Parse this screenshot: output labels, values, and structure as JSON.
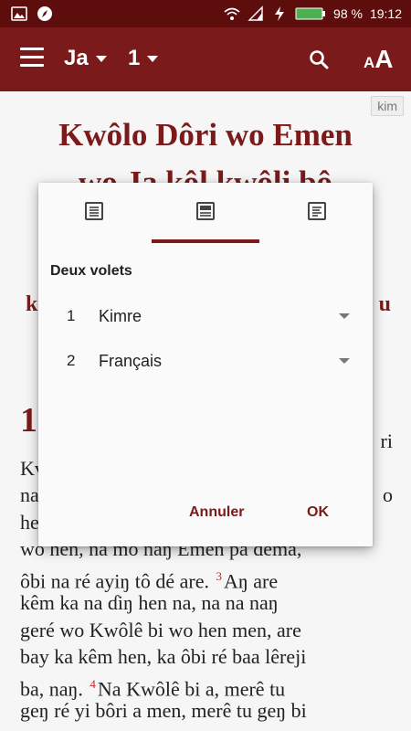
{
  "status_bar": {
    "battery": "98 %",
    "time": "19:12"
  },
  "app_bar": {
    "book": "Ja",
    "chapter": "1",
    "text_size_small": "A",
    "text_size_big": "A"
  },
  "content": {
    "lang_tag": "kim",
    "title_line1": "Kwôlo Dôri wo Emen",
    "title_line2": "wo Ja kôl kwôli bô",
    "section_heading_left": "k",
    "section_heading_right": "u",
    "chapter_number": "1",
    "lines": [
      {
        "text": "ri",
        "align": "right"
      },
      {
        "text": "Kv"
      },
      {
        "text": "na",
        "right": "o"
      },
      {
        "text": "he"
      },
      {
        "text": "wo hen, na mo naŋ Emen pa dema,"
      },
      {
        "text": "ôbi na ré ayiŋ tô dé are.",
        "verse": "3",
        "after": "Aŋ are"
      },
      {
        "text": "kêm ka na ɗiŋ hen na, na na naŋ"
      },
      {
        "text": "geré wo Kwôlê bi wo hen men, are"
      },
      {
        "text": "bay ka kêm hen, ka ôbi ré baa lêreji"
      },
      {
        "text": "ba, naŋ.",
        "verse": "4",
        "after": "Na Kwôlê bi a, merê tu"
      },
      {
        "text": "geŋ ré yi bôri a men, merê tu geŋ bi"
      }
    ]
  },
  "dialog": {
    "tabs": [
      {
        "icon": "single-pane-icon"
      },
      {
        "icon": "two-pane-icon",
        "selected": true
      },
      {
        "icon": "split-pane-icon"
      }
    ],
    "heading": "Deux volets",
    "rows": [
      {
        "num": "1",
        "value": "Kimre"
      },
      {
        "num": "2",
        "value": "Français"
      }
    ],
    "cancel_label": "Annuler",
    "ok_label": "OK"
  },
  "colors": {
    "primary": "#7a1a1a",
    "status_bar": "#5e0d0d",
    "verse_number": "#c62828"
  }
}
